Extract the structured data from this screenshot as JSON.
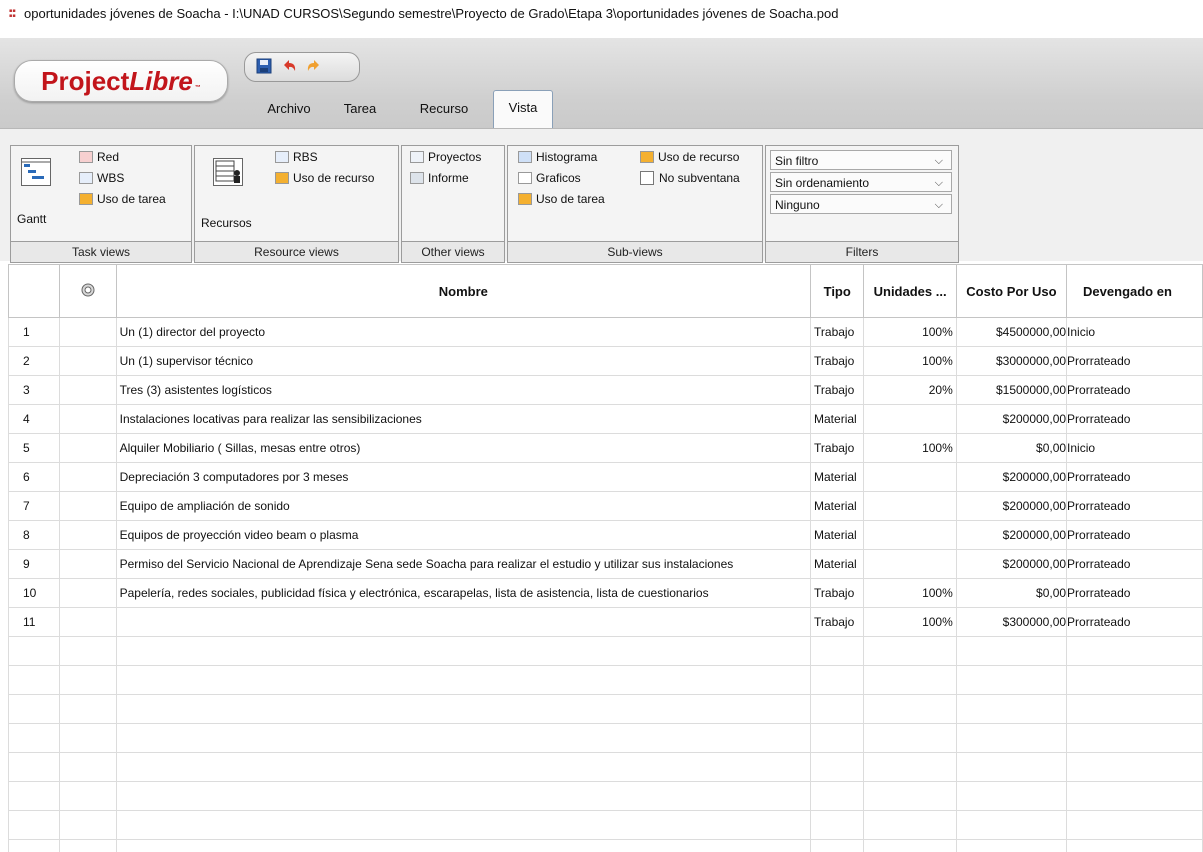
{
  "window": {
    "title": "oportunidades jóvenes de Soacha - I:\\UNAD CURSOS\\Segundo semestre\\Proyecto de Grado\\Etapa 3\\oportunidades jóvenes de Soacha.pod",
    "app_icon": "projectlibre-file-icon"
  },
  "logo": {
    "text_a": "Project",
    "text_b": "Libre",
    "tm": "™"
  },
  "quick_access": {
    "save_icon": "save-icon",
    "undo_icon": "undo-icon",
    "redo_icon": "redo-icon"
  },
  "tabs": [
    {
      "label": "Archivo"
    },
    {
      "label": "Tarea"
    },
    {
      "label": "Recurso"
    },
    {
      "label": "Vista",
      "active": true
    }
  ],
  "ribbon": {
    "task_views": {
      "title": "Task views",
      "gantt": "Gantt",
      "red": "Red",
      "wbs": "WBS",
      "uso_tarea": "Uso de tarea"
    },
    "resource_views": {
      "title": "Resource views",
      "recursos": "Recursos",
      "rbs": "RBS",
      "uso_recurso": "Uso de recurso"
    },
    "other_views": {
      "title": "Other views",
      "proyectos": "Proyectos",
      "informe": "Informe"
    },
    "sub_views": {
      "title": "Sub-views",
      "histograma": "Histograma",
      "graficos": "Graficos",
      "uso_tarea": "Uso de tarea",
      "uso_recurso": "Uso de recurso",
      "no_subventana": "No subventana"
    },
    "filters": {
      "title": "Filters",
      "filter": "Sin filtro",
      "sort": "Sin ordenamiento",
      "group": "Ninguno"
    }
  },
  "table": {
    "columns": {
      "indicator_icon": "info-indicator-icon",
      "nombre": "Nombre",
      "tipo": "Tipo",
      "unidades": "Unidades ...",
      "costo": "Costo Por Uso",
      "devengado": "Devengado en"
    },
    "rows": [
      {
        "n": "1",
        "nombre": "Un (1) director del proyecto",
        "tipo": "Trabajo",
        "unidades": "100%",
        "costo": "$4500000,00",
        "devengado": "Inicio"
      },
      {
        "n": "2",
        "nombre": "Un (1) supervisor técnico",
        "tipo": "Trabajo",
        "unidades": "100%",
        "costo": "$3000000,00",
        "devengado": "Prorrateado"
      },
      {
        "n": "3",
        "nombre": "Tres (3) asistentes logísticos",
        "tipo": "Trabajo",
        "unidades": "20%",
        "costo": "$1500000,00",
        "devengado": "Prorrateado"
      },
      {
        "n": "4",
        "nombre": "Instalaciones locativas para realizar las sensibilizaciones",
        "tipo": "Material",
        "unidades": "",
        "costo": "$200000,00",
        "devengado": "Prorrateado"
      },
      {
        "n": "5",
        "nombre": "Alquiler Mobiliario ( Sillas,  mesas entre otros)",
        "tipo": "Trabajo",
        "unidades": "100%",
        "costo": "$0,00",
        "devengado": "Inicio"
      },
      {
        "n": "6",
        "nombre": "Depreciación 3 computadores por  3 meses",
        "tipo": "Material",
        "unidades": "",
        "costo": "$200000,00",
        "devengado": "Prorrateado"
      },
      {
        "n": "7",
        "nombre": "Equipo de ampliación de sonido",
        "tipo": "Material",
        "unidades": "",
        "costo": "$200000,00",
        "devengado": "Prorrateado"
      },
      {
        "n": "8",
        "nombre": "Equipos de proyección video beam o plasma",
        "tipo": "Material",
        "unidades": "",
        "costo": "$200000,00",
        "devengado": "Prorrateado"
      },
      {
        "n": "9",
        "nombre": "Permiso del Servicio Nacional de Aprendizaje Sena sede Soacha para realizar el estudio y utilizar sus instalaciones",
        "tipo": "Material",
        "unidades": "",
        "costo": "$200000,00",
        "devengado": "Prorrateado"
      },
      {
        "n": "10",
        "nombre": "Papelería, redes sociales, publicidad física y electrónica, escarapelas, lista de asistencia, lista de cuestionarios",
        "tipo": "Trabajo",
        "unidades": "100%",
        "costo": "$0,00",
        "devengado": "Prorrateado"
      },
      {
        "n": "11",
        "nombre": "",
        "tipo": "Trabajo",
        "unidades": "100%",
        "costo": "$300000,00",
        "devengado": "Prorrateado"
      }
    ]
  }
}
